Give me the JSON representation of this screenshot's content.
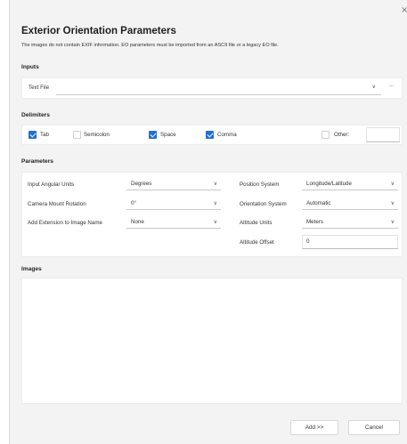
{
  "dialog": {
    "title": "Exterior Orientation Parameters",
    "subtitle": "The images do not contain EXIF information. EO parameters must be imported from an ASCII file or a legacy EO file.",
    "close_glyph": "×"
  },
  "inputs": {
    "section_label": "Inputs",
    "text_file_label": "Text File",
    "text_file_value": "",
    "dropdown_glyph": "∨",
    "browse_glyph": "···"
  },
  "delimiters": {
    "section_label": "Delimiters",
    "items": [
      {
        "label": "Tab",
        "checked": true
      },
      {
        "label": "Semicolon",
        "checked": false
      },
      {
        "label": "Space",
        "checked": true
      },
      {
        "label": "Comma",
        "checked": true
      },
      {
        "label": "Other:",
        "checked": false
      }
    ],
    "other_value": ""
  },
  "parameters": {
    "section_label": "Parameters",
    "chevron": "∨",
    "left": [
      {
        "label": "Input Angular Units",
        "value": "Degrees"
      },
      {
        "label": "Camera Mount Rotation",
        "value": "0°"
      },
      {
        "label": "Add Extension to Image Name",
        "value": "None"
      }
    ],
    "right": [
      {
        "label": "Position System",
        "value": "Longitude/Latitude"
      },
      {
        "label": "Orientation System",
        "value": "Automatic"
      },
      {
        "label": "Altitude Units",
        "value": "Meters"
      },
      {
        "label": "Altitude Offset",
        "value": "0"
      }
    ]
  },
  "images": {
    "section_label": "Images"
  },
  "footer": {
    "add_label": "Add >>",
    "cancel_label": "Cancel"
  },
  "colors": {
    "accent": "#1f6fd0",
    "dialog_bg": "#f3f3f3",
    "panel_bg": "#ffffff"
  }
}
